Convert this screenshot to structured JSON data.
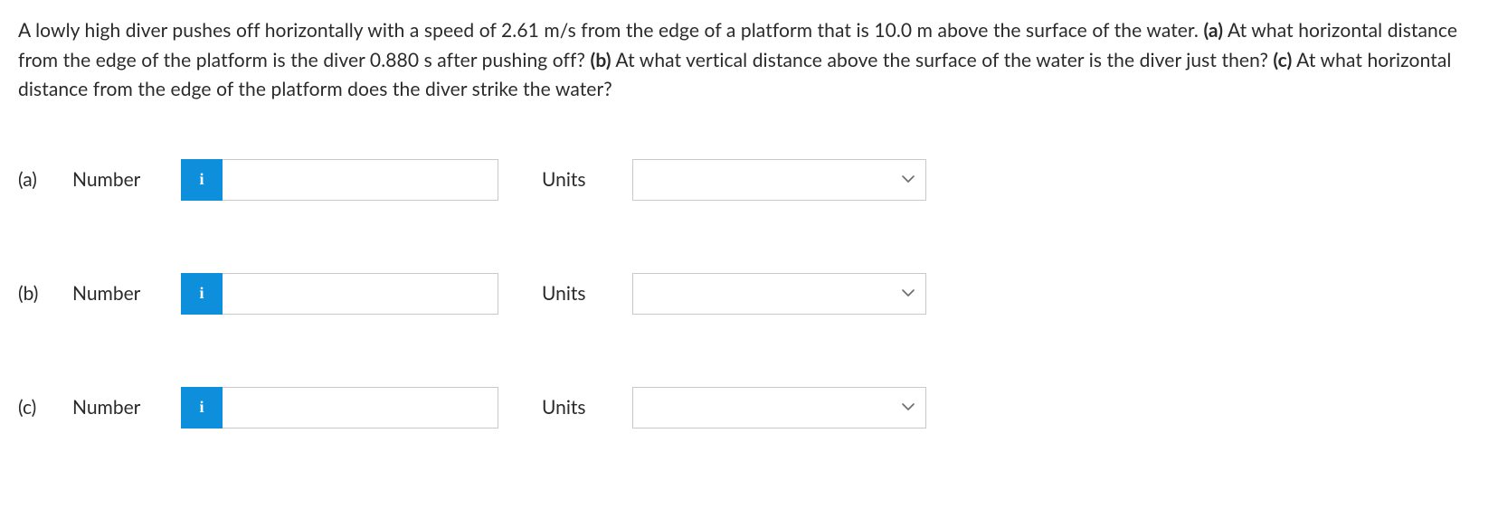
{
  "prompt": {
    "pre_a": "A lowly high diver pushes off horizontally with a speed of 2.61 m/s from the edge of a platform that is 10.0 m above the surface of the water. ",
    "bold_a": "(a)",
    "post_a": " At what horizontal distance from the edge of the platform is the diver 0.880 s after pushing off? ",
    "bold_b": "(b)",
    "post_b": " At what vertical distance above the surface of the water is the diver just then? ",
    "bold_c": "(c)",
    "post_c": " At what horizontal distance from the edge of the platform does the diver strike the water?"
  },
  "labels": {
    "number": "Number",
    "units": "Units",
    "info_glyph": "i"
  },
  "parts": {
    "a": {
      "label": "(a)",
      "value": "",
      "units": ""
    },
    "b": {
      "label": "(b)",
      "value": "",
      "units": ""
    },
    "c": {
      "label": "(c)",
      "value": "",
      "units": ""
    }
  }
}
